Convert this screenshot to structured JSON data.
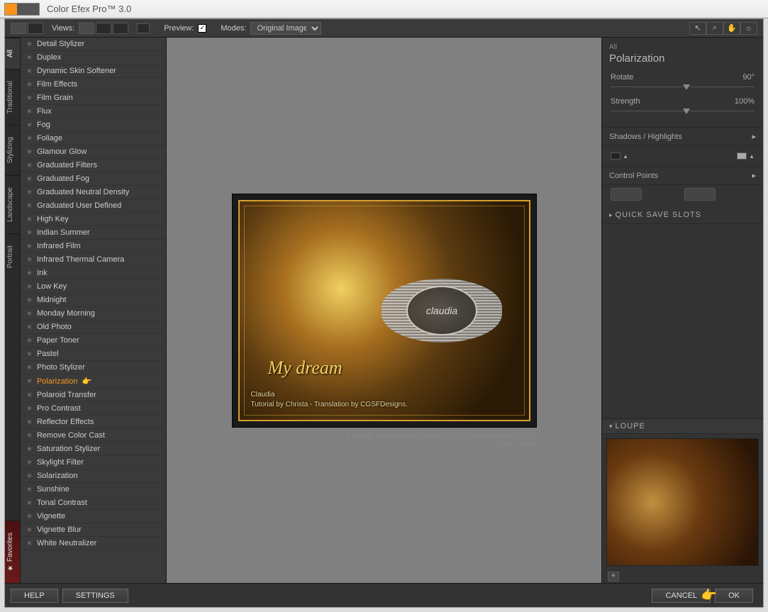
{
  "app_title": "Color Efex Pro™ 3.0",
  "toolbar": {
    "views_label": "Views:",
    "preview_label": "Preview:",
    "modes_label": "Modes:",
    "mode_value": "Original Image"
  },
  "vertical_tabs": [
    "All",
    "Traditional",
    "Stylizing",
    "Landscape",
    "Portrait"
  ],
  "fav_tab": "★ Favorites",
  "filters": [
    "Detail Stylizer",
    "Duplex",
    "Dynamic Skin Softener",
    "Film Effects",
    "Film Grain",
    "Flux",
    "Fog",
    "Foliage",
    "Glamour Glow",
    "Graduated Filters",
    "Graduated Fog",
    "Graduated Neutral Density",
    "Graduated User Defined",
    "High Key",
    "Indian Summer",
    "Infrared Film",
    "Infrared Thermal Camera",
    "Ink",
    "Low Key",
    "Midnight",
    "Monday Morning",
    "Old Photo",
    "Paper Toner",
    "Pastel",
    "Photo Stylizer",
    "Polarization",
    "Polaroid Transfer",
    "Pro Contrast",
    "Reflector Effects",
    "Remove Color Cast",
    "Saturation Stylizer",
    "Skylight Filter",
    "Solarization",
    "Sunshine",
    "Tonal Contrast",
    "Vignette",
    "Vignette Blur",
    "White Neutralizer"
  ],
  "selected_filter": "Polarization",
  "image": {
    "overlay_name": "Claudia",
    "overlay_credit": "Tutorial by Christa - Translation by CGSFDesigns.",
    "script_title": "My dream",
    "caption": "Les-My-Dream-van-Christa-CGSFDesigns-04-09-2021",
    "dims": "(860 x 660)"
  },
  "watermark": "claudia",
  "panel": {
    "category": "All",
    "title": "Polarization",
    "rotate_label": "Rotate",
    "rotate_value": "90°",
    "strength_label": "Strength",
    "strength_value": "100%",
    "shadows_label": "Shadows / Highlights",
    "control_points_label": "Control Points",
    "quick_save": "QUICK SAVE SLOTS",
    "loupe": "LOUPE"
  },
  "buttons": {
    "help": "HELP",
    "settings": "SETTINGS",
    "cancel": "CANCEL",
    "ok": "OK"
  }
}
